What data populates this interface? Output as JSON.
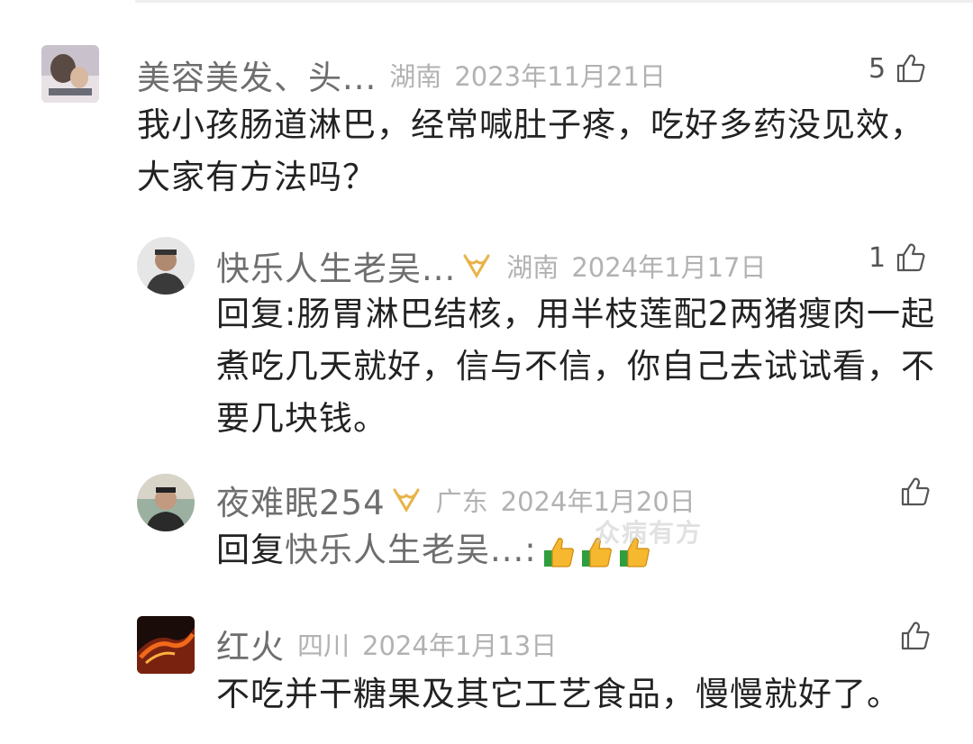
{
  "comments": [
    {
      "username": "美容美发、头...",
      "location": "湖南",
      "date": "2023年11月21日",
      "likes": "5",
      "text": "我小孩肠道淋巴，经常喊肚子疼，吃好多药没见效，大家有方法吗？"
    },
    {
      "username": "快乐人生老吴...",
      "location": "湖南",
      "date": "2024年1月17日",
      "likes": "1",
      "text": "回复:肠胃淋巴结核，用半枝莲配2两猪瘦肉一起煮吃几天就好，信与不信，你自己去试试看，不要几块钱。"
    },
    {
      "username": "夜难眠254",
      "location": "广东",
      "date": "2024年1月20日",
      "likes": "",
      "reply_prefix": "回复",
      "mention": "快乐人生老吴...:",
      "emojis": [
        "thumbs-up-emoji",
        "thumbs-up-emoji",
        "thumbs-up-emoji"
      ]
    },
    {
      "username": "红火",
      "location": "四川",
      "date": "2024年1月13日",
      "likes": "",
      "text": "不吃并干糖果及其它工艺食品，慢慢就好了。"
    }
  ],
  "watermark": "众病有方",
  "colors": {
    "username": "#6e6e6e",
    "meta": "#b2b2b2",
    "text": "#222222",
    "badge": "#e8b34a"
  }
}
